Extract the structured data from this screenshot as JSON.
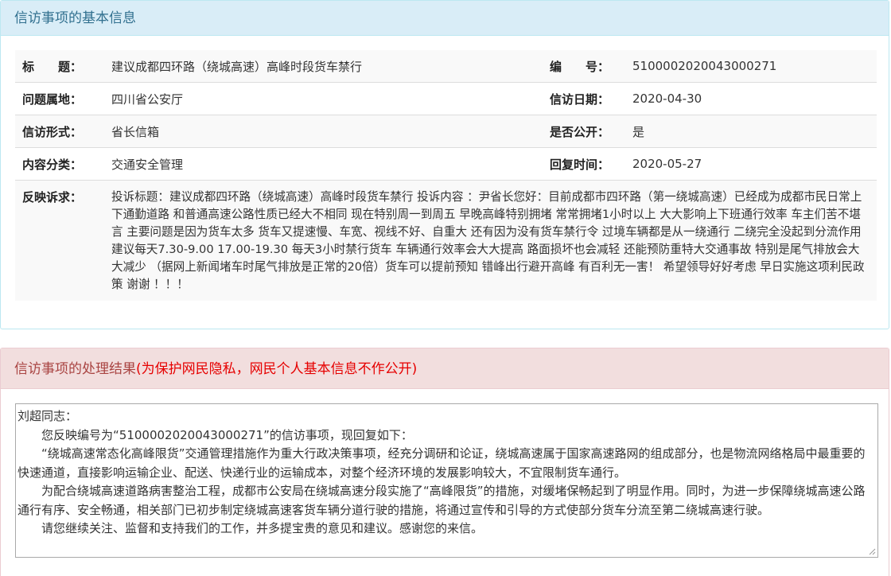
{
  "basic": {
    "header": "信访事项的基本信息",
    "title_label": "标　　题：",
    "title_value": "建议成都四环路（绕城高速）高峰时段货车禁行",
    "number_label": "编　　号：",
    "number_value": "5100002020043000271",
    "location_label": "问题属地：",
    "location_value": "四川省公安厅",
    "date_label": "信访日期：",
    "date_value": "2020-04-30",
    "form_label": "信访形式：",
    "form_value": "省长信箱",
    "public_label": "是否公开：",
    "public_value": "是",
    "category_label": "内容分类：",
    "category_value": "交通安全管理",
    "reply_time_label": "回复时间：",
    "reply_time_value": "2020-05-27",
    "appeal_label": "反映诉求：",
    "appeal_value": "投诉标题：建议成都四环路（绕城高速）高峰时段货车禁行 投诉内容 ：尹省长您好：目前成都市四环路（第一绕城高速）已经成为成都市民日常上下通勤道路 和普通高速公路性质已经大不相同 现在特别周一到周五 早晚高峰特别拥堵 常常拥堵1小时以上 大大影响上下班通行效率 车主们苦不堪言 主要问题是因为货车太多 货车又提速慢、车宽、视线不好、自重大 还有因为没有货车禁行令 过境车辆都是从一绕通行 二绕完全没起到分流作用 建议每天7.30-9.00 17.00-19.30 每天3小时禁行货车 车辆通行效率会大大提高 路面损坏也会减轻 还能预防重特大交通事故 特别是尾气排放会大大减少 （据网上新闻堵车时尾气排放是正常的20倍）货车可以提前预知 错峰出行避开高峰 有百利无一害！ 希望领导好好考虑 早日实施这项利民政策 谢谢 ！！！"
  },
  "result": {
    "header": "信访事项的处理结果",
    "header_note": "(为保护网民隐私，网民个人基本信息不作公开)",
    "reply_greeting": "刘超同志：",
    "reply_p1": "您反映编号为“5100002020043000271”的信访事项，现回复如下：",
    "reply_p2": "“绕城高速常态化高峰限货”交通管理措施作为重大行政决策事项，经充分调研和论证，绕城高速属于国家高速路网的组成部分，也是物流网络格局中最重要的快速通道，直接影响运输企业、配送、快递行业的运输成本，对整个经济环境的发展影响较大，不宜限制货车通行。",
    "reply_p3": "为配合绕城高速道路病害整治工程，成都市公安局在绕城高速分段实施了“高峰限货”的措施，对缓堵保畅起到了明显作用。同时，为进一步保障绕城高速公路通行有序、安全畅通，相关部门已初步制定绕城高速客货车辆分道行驶的措施，将通过宣传和引导的方式使部分货车分流至第二绕城高速行驶。",
    "reply_p4": "请您继续关注、监督和支持我们的工作，并多提宝贵的意见和建议。感谢您的来信。"
  }
}
